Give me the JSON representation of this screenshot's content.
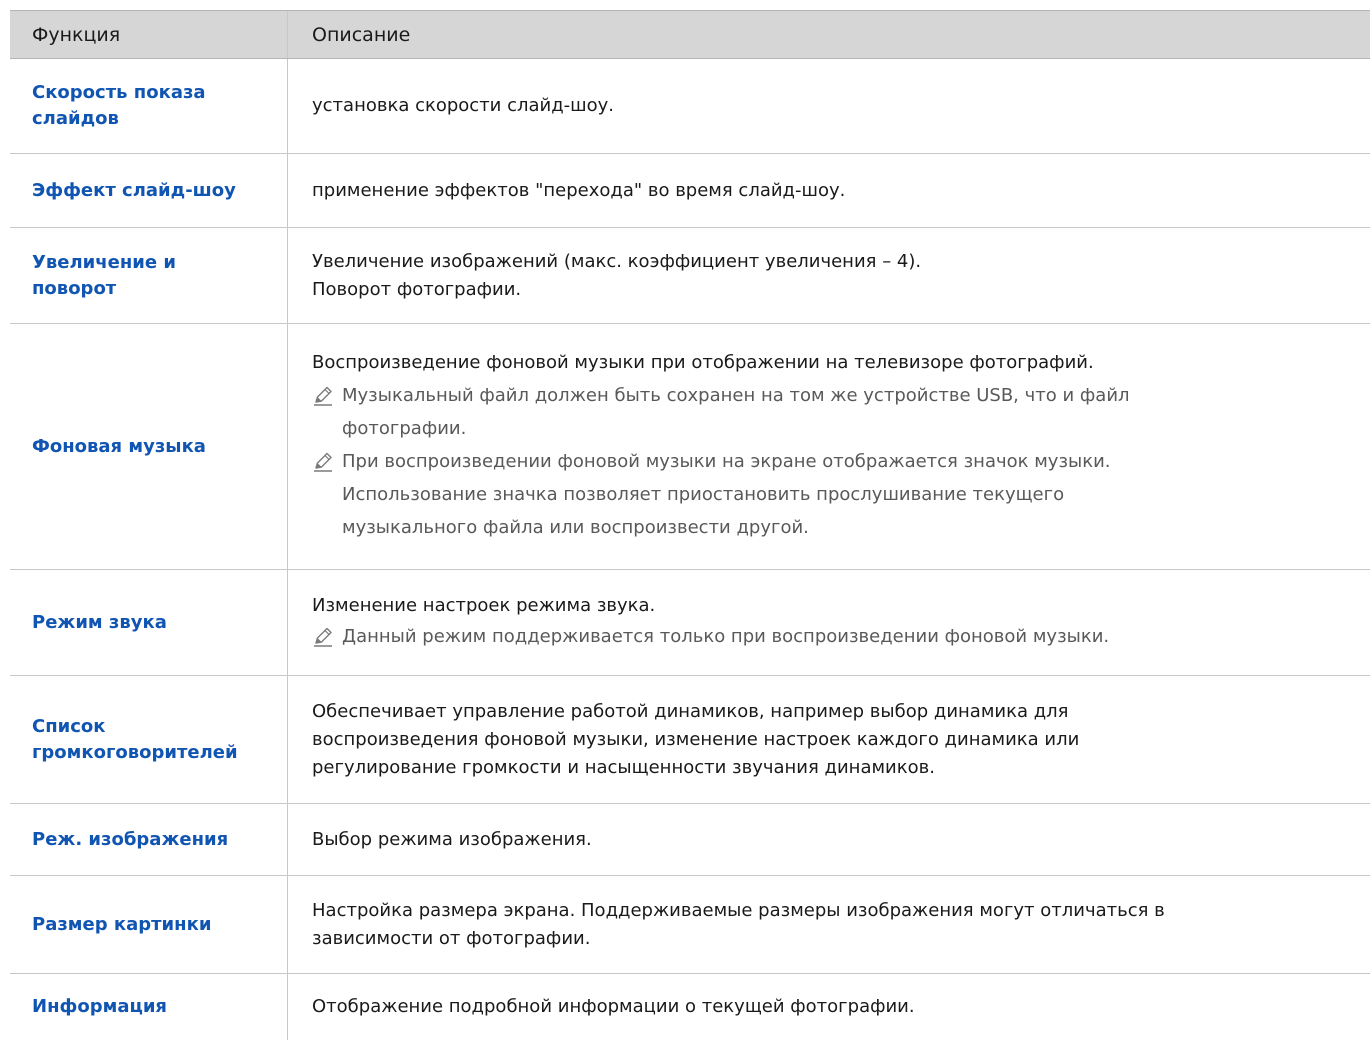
{
  "header": {
    "col_function": "Функция",
    "col_description": "Описание"
  },
  "rows": [
    {
      "function": [
        "Скорость показа",
        "слайдов"
      ],
      "description": [
        "установка скорости слайд-шоу."
      ],
      "notes": []
    },
    {
      "function": [
        "Эффект слайд-шоу"
      ],
      "description": [
        "применение эффектов \"перехода\" во время слайд-шоу."
      ],
      "notes": []
    },
    {
      "function": [
        "Увеличение и",
        "поворот"
      ],
      "description": [
        "Увеличение изображений (макс. коэффициент увеличения – 4).",
        "Поворот фотографии."
      ],
      "notes": []
    },
    {
      "function": [
        "Фоновая музыка"
      ],
      "description": [
        "Воспроизведение фоновой музыки при отображении на телевизоре фотографий."
      ],
      "notes": [
        [
          "Музыкальный файл должен быть сохранен на том же устройстве USB, что и файл",
          "фотографии."
        ],
        [
          "При воспроизведении фоновой музыки на экране отображается значок музыки.",
          "Использование значка позволяет приостановить прослушивание текущего",
          "музыкального файла или воспроизвести другой."
        ]
      ]
    },
    {
      "function": [
        "Режим звука"
      ],
      "description": [
        "Изменение настроек режима звука."
      ],
      "notes": [
        [
          "Данный режим поддерживается только при воспроизведении фоновой музыки."
        ]
      ]
    },
    {
      "function": [
        "Список",
        "громкоговорителей"
      ],
      "description": [
        "Обеспечивает управление работой динамиков, например выбор динамика для",
        "воспроизведения фоновой музыки, изменение настроек каждого динамика или",
        "регулирование громкости и насыщенности звучания динамиков."
      ],
      "notes": []
    },
    {
      "function": [
        "Реж. изображения"
      ],
      "description": [
        "Выбор режима изображения."
      ],
      "notes": []
    },
    {
      "function": [
        "Размер картинки"
      ],
      "description": [
        "Настройка размера экрана. Поддерживаемые размеры изображения могут отличаться в",
        "зависимости от фотографии."
      ],
      "notes": []
    },
    {
      "function": [
        "Информация"
      ],
      "description": [
        "Отображение подробной информации о текущей фотографии."
      ],
      "notes": []
    }
  ],
  "icons": {
    "note": "pencil-note-icon"
  },
  "colors": {
    "function_label": "#1155b3",
    "header_background": "#d6d6d6"
  }
}
